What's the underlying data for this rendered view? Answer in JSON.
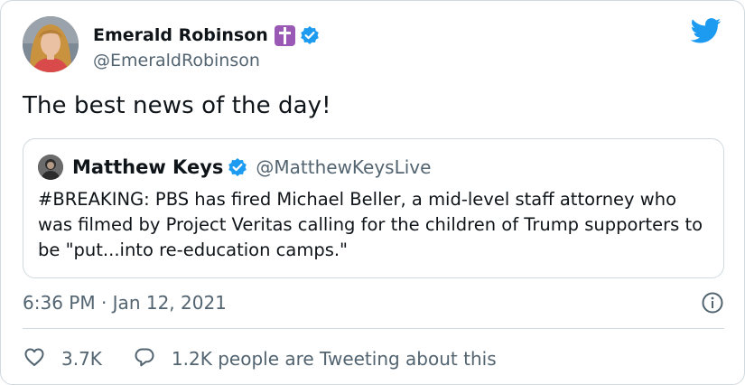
{
  "colors": {
    "accent": "#1d9bf0",
    "text_primary": "#0f1419",
    "text_secondary": "#536471",
    "border": "#cfd9de",
    "cross_emoji_bg": "#9b59b6"
  },
  "icons": {
    "brand": "twitter-bird-icon",
    "verified": "verified-badge-icon",
    "emoji": "latin-cross-emoji",
    "info": "info-icon",
    "like": "heart-icon",
    "reply": "reply-bubble-icon"
  },
  "tweet": {
    "author": {
      "display_name": "Emerald Robinson",
      "handle": "@EmeraldRobinson"
    },
    "text": "The best news of the day!",
    "quoted": {
      "display_name": "Matthew Keys",
      "handle": "@MatthewKeysLive",
      "text": "#BREAKING: PBS has fired Michael Beller, a mid-level staff attorney who was filmed by Project Veritas calling for the children of Trump supporters to be \"put...into re-education camps.\""
    },
    "timestamp": "6:36 PM · Jan 12, 2021",
    "likes": "3.7K",
    "tweeting": "1.2K people are Tweeting about this"
  }
}
